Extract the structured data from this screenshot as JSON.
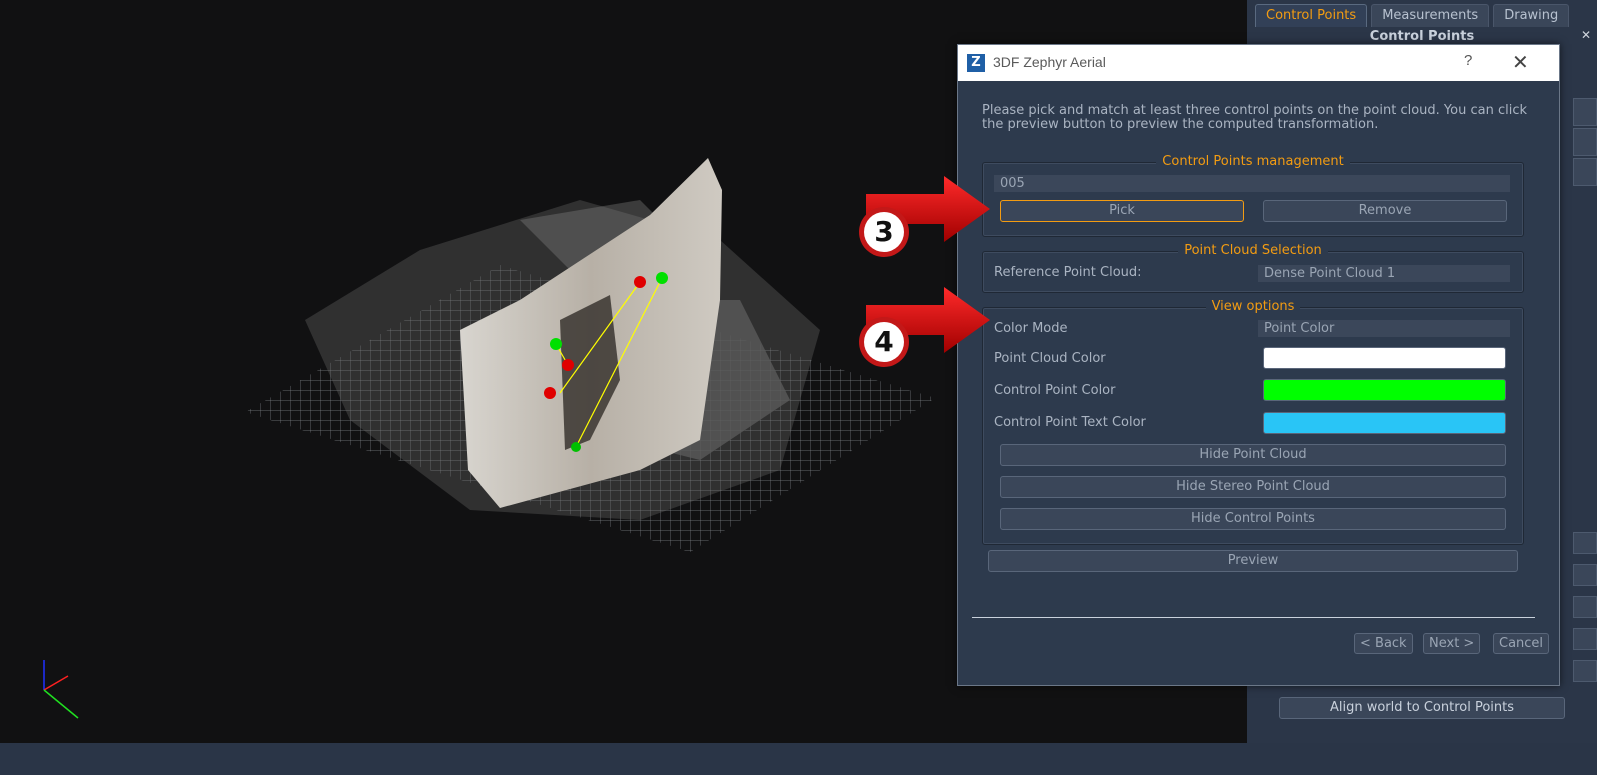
{
  "right_panel": {
    "tabs": [
      {
        "label": "Control Points",
        "active": true
      },
      {
        "label": "Measurements",
        "active": false
      },
      {
        "label": "Drawing",
        "active": false
      }
    ],
    "title": "Control Points",
    "close_glyph": "✕",
    "align_button": "Align world to Control Points"
  },
  "dialog": {
    "app_icon_letter": "Z",
    "title": "3DF Zephyr Aerial",
    "help_glyph": "?",
    "close_glyph": "✕",
    "intro": "Please pick and match at least three control points on the point cloud. You can click the preview button to preview the computed transformation.",
    "management": {
      "title": "Control Points management",
      "current_point": "005",
      "pick_label": "Pick",
      "remove_label": "Remove"
    },
    "selection": {
      "title": "Point Cloud Selection",
      "reference_label": "Reference Point Cloud:",
      "reference_value": "Dense Point Cloud 1"
    },
    "view_options": {
      "title": "View options",
      "color_mode_label": "Color Mode",
      "color_mode_value": "Point Color",
      "point_cloud_color_label": "Point Cloud Color",
      "control_point_color_label": "Control Point Color",
      "control_point_text_color_label": "Control Point Text Color",
      "hide_point_cloud": "Hide Point Cloud",
      "hide_stereo_point_cloud": "Hide Stereo Point Cloud",
      "hide_control_points": "Hide Control Points"
    },
    "preview_label": "Preview",
    "back_label": "< Back",
    "next_label": "Next >",
    "cancel_label": "Cancel"
  },
  "callouts": [
    "3",
    "4"
  ],
  "colors": {
    "accent": "#f39c12",
    "point_cloud_color": "#ffffff",
    "control_point_color": "#00ff00",
    "control_point_text_color": "#29c5f6",
    "callout_red": "#d40000"
  }
}
